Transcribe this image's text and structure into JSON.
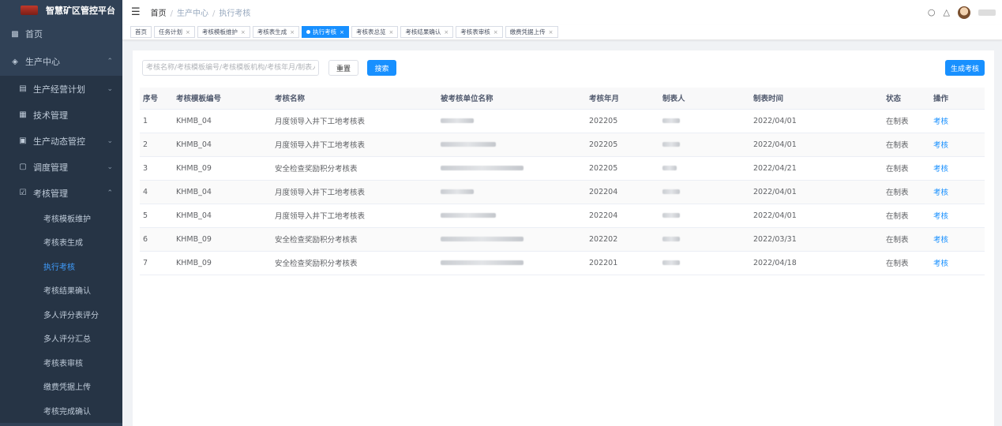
{
  "app": {
    "title": "智慧矿区管控平台"
  },
  "sidebar": {
    "items": [
      {
        "label": "首页",
        "icon": "dashboard-icon"
      },
      {
        "label": "生产中心",
        "icon": "layers-icon"
      }
    ],
    "production": [
      {
        "label": "生产经营计划",
        "icon": "board-icon"
      },
      {
        "label": "技术管理",
        "icon": "doc-icon"
      },
      {
        "label": "生产动态管控",
        "icon": "form-icon"
      },
      {
        "label": "调度管理",
        "icon": "window-icon"
      },
      {
        "label": "考核管理",
        "icon": "checkbox-icon"
      }
    ],
    "assessment": [
      "考核模板维护",
      "考核表生成",
      "执行考核",
      "考核结果确认",
      "多人评分表评分",
      "多人评分汇总",
      "考核表审核",
      "缴费凭据上传",
      "考核完成确认"
    ],
    "active_sub": "执行考核"
  },
  "navbar": {
    "breadcrumb": [
      "首页",
      "生产中心",
      "执行考核"
    ]
  },
  "tags": [
    {
      "label": "首页",
      "closable": false
    },
    {
      "label": "任务计划",
      "closable": true
    },
    {
      "label": "考核模板维护",
      "closable": true
    },
    {
      "label": "考核表生成",
      "closable": true
    },
    {
      "label": "执行考核",
      "closable": true,
      "active": true
    },
    {
      "label": "考核表总览",
      "closable": true
    },
    {
      "label": "考核结果确认",
      "closable": true
    },
    {
      "label": "考核表审核",
      "closable": true
    },
    {
      "label": "缴费凭据上传",
      "closable": true
    }
  ],
  "toolbar": {
    "search_placeholder": "考核名称/考核模板编号/考核模板机构/考核年月/制表人",
    "reset_label": "重置",
    "search_label": "搜索",
    "generate_label": "生成考核"
  },
  "table": {
    "headers": [
      "序号",
      "考核模板编号",
      "考核名称",
      "被考核单位名称",
      "考核年月",
      "制表人",
      "制表时间",
      "状态",
      "操作"
    ],
    "rows": [
      {
        "no": "1",
        "code": "KHMB_04",
        "name": "月度领导入井下工地考核表",
        "period": "202205",
        "time": "2022/04/01",
        "status": "在制表",
        "action": "考核",
        "unit_w": 42,
        "user_w": 22
      },
      {
        "no": "2",
        "code": "KHMB_04",
        "name": "月度领导入井下工地考核表",
        "period": "202205",
        "time": "2022/04/01",
        "status": "在制表",
        "action": "考核",
        "unit_w": 70,
        "user_w": 22
      },
      {
        "no": "3",
        "code": "KHMB_09",
        "name": "安全检查奖励积分考核表",
        "period": "202205",
        "time": "2022/04/21",
        "status": "在制表",
        "action": "考核",
        "unit_w": 105,
        "user_w": 18
      },
      {
        "no": "4",
        "code": "KHMB_04",
        "name": "月度领导入井下工地考核表",
        "period": "202204",
        "time": "2022/04/01",
        "status": "在制表",
        "action": "考核",
        "unit_w": 42,
        "user_w": 22
      },
      {
        "no": "5",
        "code": "KHMB_04",
        "name": "月度领导入井下工地考核表",
        "period": "202204",
        "time": "2022/04/01",
        "status": "在制表",
        "action": "考核",
        "unit_w": 70,
        "user_w": 22
      },
      {
        "no": "6",
        "code": "KHMB_09",
        "name": "安全检查奖励积分考核表",
        "period": "202202",
        "time": "2022/03/31",
        "status": "在制表",
        "action": "考核",
        "unit_w": 105,
        "user_w": 22
      },
      {
        "no": "7",
        "code": "KHMB_09",
        "name": "安全检查奖励积分考核表",
        "period": "202201",
        "time": "2022/04/18",
        "status": "在制表",
        "action": "考核",
        "unit_w": 105,
        "user_w": 22
      }
    ]
  },
  "colors": {
    "primary": "#1890ff",
    "sidebar_bg": "#304156",
    "submenu_bg": "#263445"
  }
}
